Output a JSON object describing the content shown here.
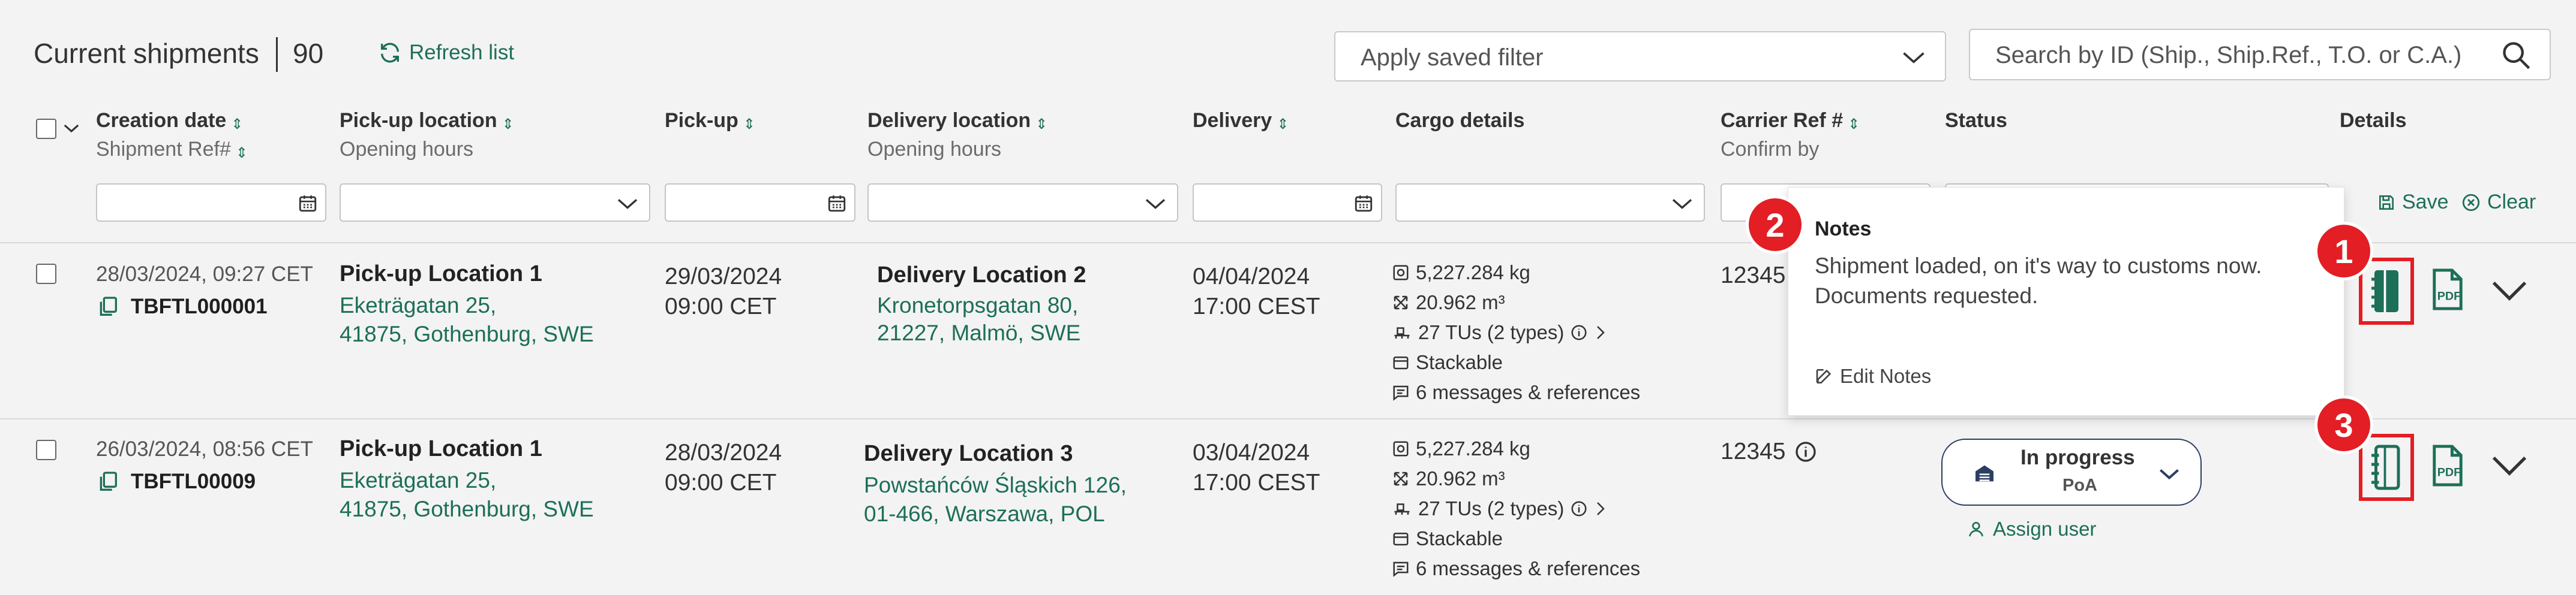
{
  "header": {
    "title": "Current shipments",
    "count": "90",
    "refresh_label": "Refresh list",
    "saved_filter_placeholder": "Apply saved filter",
    "search_placeholder": "Search by ID (Ship., Ship.Ref., T.O. or C.A.)"
  },
  "columns": {
    "creation_date": "Creation date",
    "shipment_ref": "Shipment Ref#",
    "pickup_location": "Pick-up location",
    "opening_hours": "Opening hours",
    "pickup": "Pick-up",
    "delivery_location": "Delivery location",
    "delivery_opening_hours": "Opening hours",
    "delivery": "Delivery",
    "cargo_details": "Cargo details",
    "carrier_ref": "Carrier Ref #",
    "confirm_by": "Confirm by",
    "status": "Status",
    "details": "Details"
  },
  "filter_actions": {
    "save": "Save",
    "clear": "Clear"
  },
  "rows": [
    {
      "created": "28/03/2024, 09:27 CET",
      "shipment_ref": "TBFTL000001",
      "pickup_name": "Pick-up Location 1",
      "pickup_addr1": "Eketrägatan 25,",
      "pickup_addr2": "41875, Gothenburg, SWE",
      "pickup_date": "29/03/2024",
      "pickup_time": "09:00 CET",
      "delivery_name": "Delivery Location 2",
      "delivery_addr1": "Kronetorpsgatan 80,",
      "delivery_addr2": "21227, Malmö, SWE",
      "delivery_date": "04/04/2024",
      "delivery_time": "17:00 CEST",
      "weight": "5,227.284 kg",
      "volume": "20.962 m³",
      "tus": "27 TUs (2 types)",
      "stackable": "Stackable",
      "messages": "6 messages & references",
      "carrier_ref": "12345"
    },
    {
      "created": "26/03/2024, 08:56 CET",
      "shipment_ref": "TBFTL00009",
      "pickup_name": "Pick-up Location 1",
      "pickup_addr1": "Eketrägatan 25,",
      "pickup_addr2": "41875, Gothenburg, SWE",
      "pickup_date": "28/03/2024",
      "pickup_time": "09:00 CET",
      "delivery_name": "Delivery Location 3",
      "delivery_addr1": "Powstańców Śląskich 126,",
      "delivery_addr2": "01-466, Warszawa, POL",
      "delivery_date": "03/04/2024",
      "delivery_time": "17:00 CEST",
      "weight": "5,227.284 kg",
      "volume": "20.962 m³",
      "tus": "27 TUs (2 types)",
      "stackable": "Stackable",
      "messages": "6 messages & references",
      "carrier_ref": "12345",
      "status_label": "In progress",
      "status_sub": "PoA",
      "assign_user": "Assign user"
    }
  ],
  "notes_popup": {
    "title": "Notes",
    "text_line1": "Shipment loaded, on it's way to customs now.",
    "text_line2": "Documents requested.",
    "edit_label": "Edit Notes"
  },
  "badges": {
    "one": "1",
    "two": "2",
    "three": "3"
  },
  "icons": {
    "refresh": "refresh-icon",
    "calendar": "calendar-icon",
    "chevron": "chevron-down-icon",
    "search": "search-icon",
    "notes": "notes-icon",
    "pdf": "pdf-icon",
    "copy": "copy-icon",
    "weight": "weight-icon",
    "volume": "volume-icon",
    "pallet": "pallet-icon",
    "stack": "stackable-icon",
    "message": "message-icon",
    "info": "info-icon",
    "user": "user-icon"
  },
  "colors": {
    "accent_green": "#1d6f57",
    "highlight_red": "#e31e24",
    "status_border": "#2c3e62"
  }
}
